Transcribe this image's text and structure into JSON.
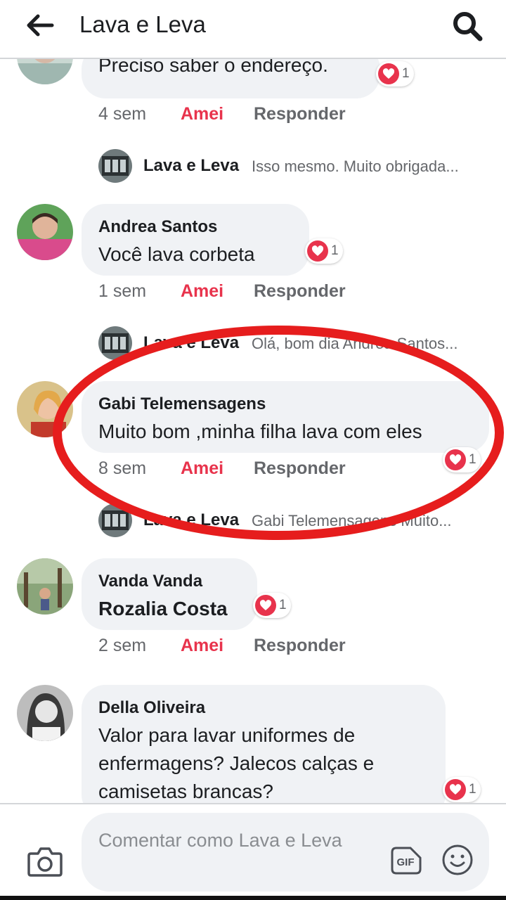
{
  "header": {
    "title": "Lava e Leva"
  },
  "comments": [
    {
      "author": "",
      "text": "Preciso saber o endereço.",
      "reactions": "1",
      "time": "4 sem",
      "like_label": "Amei",
      "reply_label": "Responder",
      "reply": {
        "author": "Lava e Leva",
        "text": "Isso mesmo. Muito obrigada..."
      }
    },
    {
      "author": "Andrea Santos",
      "text": "Você  lava  corbeta",
      "reactions": "1",
      "time": "1 sem",
      "like_label": "Amei",
      "reply_label": "Responder",
      "reply": {
        "author": "Lava e Leva",
        "text": "Olá, bom dia Andrea Santos..."
      }
    },
    {
      "author": "Gabi Telemensagens",
      "text": "Muito bom ,minha filha lava com eles",
      "reactions": "1",
      "time": "8 sem",
      "like_label": "Amei",
      "reply_label": "Responder",
      "reply": {
        "author": "Lava e Leva",
        "text": "Gabi Telemensagens Muito..."
      }
    },
    {
      "author": "Vanda Vanda",
      "text": "Rozalia Costa",
      "reactions": "1",
      "time": "2 sem",
      "like_label": "Amei",
      "reply_label": "Responder"
    },
    {
      "author": "Della Oliveira",
      "text": "Valor para lavar uniformes de enfermagens? Jalecos calças e camisetas brancas?",
      "reactions": "1"
    }
  ],
  "composer": {
    "placeholder": "Comentar como Lava e Leva",
    "gif_label": "GIF"
  },
  "colors": {
    "accent_red": "#e8334c",
    "bubble_bg": "#f0f2f5",
    "secondary_text": "#65676b",
    "highlight_ring": "#e61d1d"
  }
}
